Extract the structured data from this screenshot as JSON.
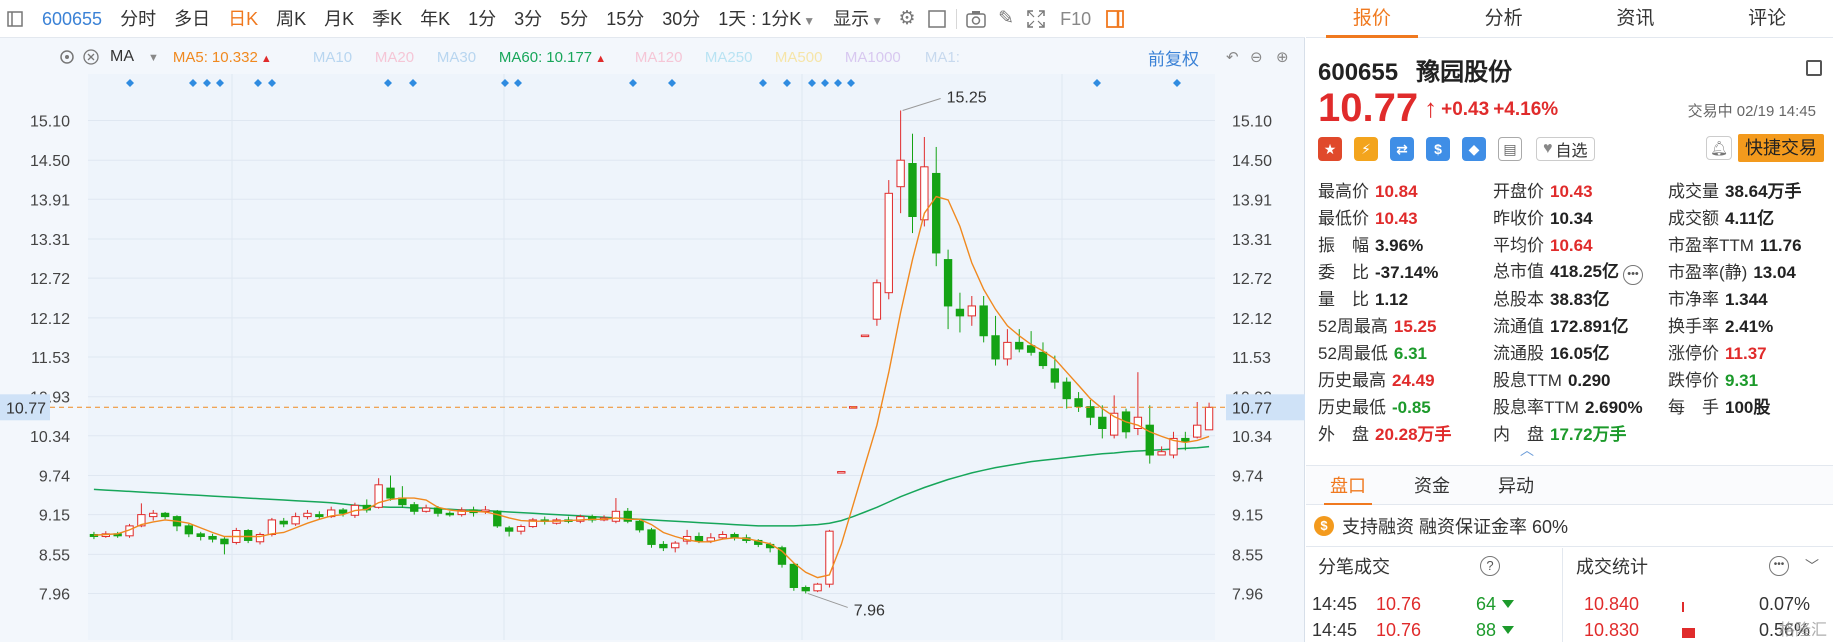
{
  "toolbar": {
    "code": "600655",
    "items": [
      {
        "label": "分时",
        "active": false
      },
      {
        "label": "多日",
        "active": false
      },
      {
        "label": "日K",
        "active": true
      },
      {
        "label": "周K",
        "active": false
      },
      {
        "label": "月K",
        "active": false
      },
      {
        "label": "季K",
        "active": false
      },
      {
        "label": "年K",
        "active": false
      },
      {
        "label": "1分",
        "active": false
      },
      {
        "label": "3分",
        "active": false
      },
      {
        "label": "5分",
        "active": false
      },
      {
        "label": "15分",
        "active": false
      },
      {
        "label": "30分",
        "active": false
      }
    ],
    "period_select": "1天 : 1分K",
    "display_label": "显示",
    "f10_label": "F10"
  },
  "ma_bar": {
    "type_label": "MA",
    "items": [
      {
        "label": "MA5:",
        "value": "10.332",
        "color": "#f0891f",
        "arrow": "up"
      },
      {
        "label": "MA10",
        "value": "",
        "color": "#b8d6f0",
        "arrow": ""
      },
      {
        "label": "MA20",
        "value": "",
        "color": "#f5c6d6",
        "arrow": ""
      },
      {
        "label": "MA30",
        "value": "",
        "color": "#b8d6f0",
        "arrow": ""
      },
      {
        "label": "MA60:",
        "value": "10.177",
        "color": "#17a65a",
        "arrow": "up"
      },
      {
        "label": "MA120",
        "value": "",
        "color": "#f5c6d6",
        "arrow": ""
      },
      {
        "label": "MA250",
        "value": "",
        "color": "#b9e3f3",
        "arrow": ""
      },
      {
        "label": "MA500",
        "value": "",
        "color": "#f6e5a8",
        "arrow": ""
      },
      {
        "label": "MA1000",
        "value": "",
        "color": "#d8c8f0",
        "arrow": ""
      },
      {
        "label": "MA1:",
        "value": "",
        "color": "#c7d9ee",
        "arrow": ""
      }
    ],
    "adjust_label": "前复权"
  },
  "chart_data": {
    "type": "candlestick",
    "y_ticks": [
      "15.10",
      "14.50",
      "13.91",
      "13.31",
      "12.72",
      "12.12",
      "11.53",
      "10.93",
      "10.34",
      "9.74",
      "9.15",
      "8.55",
      "7.96"
    ],
    "y_range": [
      7.68,
      15.62
    ],
    "current_price": "10.77",
    "high_label": "15.25",
    "low_label": "7.96",
    "candles": [
      [
        8.85,
        8.82,
        8.89,
        8.78
      ],
      [
        8.82,
        8.86,
        8.9,
        8.8
      ],
      [
        8.86,
        8.83,
        8.89,
        8.8
      ],
      [
        8.83,
        8.98,
        9.01,
        8.8
      ],
      [
        8.98,
        9.15,
        9.32,
        8.96
      ],
      [
        9.12,
        9.17,
        9.22,
        9.06
      ],
      [
        9.17,
        9.12,
        9.19,
        9.08
      ],
      [
        9.12,
        8.98,
        9.14,
        8.9
      ],
      [
        8.98,
        8.86,
        9.01,
        8.81
      ],
      [
        8.86,
        8.82,
        8.89,
        8.76
      ],
      [
        8.82,
        8.78,
        8.86,
        8.73
      ],
      [
        8.78,
        8.71,
        8.81,
        8.55
      ],
      [
        8.73,
        8.91,
        8.95,
        8.7
      ],
      [
        8.91,
        8.76,
        8.93,
        8.72
      ],
      [
        8.74,
        8.85,
        8.88,
        8.7
      ],
      [
        8.85,
        9.07,
        9.1,
        8.82
      ],
      [
        9.05,
        9.01,
        9.1,
        8.96
      ],
      [
        9.01,
        9.12,
        9.18,
        8.98
      ],
      [
        9.12,
        9.17,
        9.22,
        9.08
      ],
      [
        9.15,
        9.12,
        9.2,
        9.08
      ],
      [
        9.12,
        9.22,
        9.27,
        9.1
      ],
      [
        9.22,
        9.17,
        9.25,
        9.12
      ],
      [
        9.14,
        9.29,
        9.33,
        9.1
      ],
      [
        9.29,
        9.22,
        9.38,
        9.18
      ],
      [
        9.26,
        9.6,
        9.7,
        9.24
      ],
      [
        9.55,
        9.4,
        9.74,
        9.36
      ],
      [
        9.4,
        9.3,
        9.58,
        9.25
      ],
      [
        9.3,
        9.2,
        9.34,
        9.15
      ],
      [
        9.2,
        9.25,
        9.3,
        9.18
      ],
      [
        9.25,
        9.17,
        9.28,
        9.12
      ],
      [
        9.17,
        9.15,
        9.2,
        9.12
      ],
      [
        9.15,
        9.22,
        9.26,
        9.12
      ],
      [
        9.22,
        9.18,
        9.27,
        9.12
      ],
      [
        9.2,
        9.22,
        9.28,
        9.16
      ],
      [
        9.2,
        8.98,
        9.22,
        8.95
      ],
      [
        8.95,
        8.9,
        8.98,
        8.82
      ],
      [
        8.9,
        8.97,
        9.0,
        8.85
      ],
      [
        8.97,
        9.07,
        9.1,
        8.95
      ],
      [
        9.07,
        9.05,
        9.12,
        9.0
      ],
      [
        9.02,
        9.07,
        9.1,
        9.0
      ],
      [
        9.07,
        9.05,
        9.12,
        9.02
      ],
      [
        9.05,
        9.12,
        9.15,
        9.02
      ],
      [
        9.12,
        9.07,
        9.15,
        9.03
      ],
      [
        9.07,
        9.1,
        9.14,
        9.05
      ],
      [
        9.05,
        9.2,
        9.4,
        9.02
      ],
      [
        9.2,
        9.05,
        9.25,
        9.02
      ],
      [
        9.05,
        8.92,
        9.07,
        8.88
      ],
      [
        8.92,
        8.7,
        8.95,
        8.65
      ],
      [
        8.7,
        8.65,
        8.75,
        8.6
      ],
      [
        8.65,
        8.72,
        8.75,
        8.58
      ],
      [
        8.75,
        8.82,
        8.92,
        8.7
      ],
      [
        8.82,
        8.75,
        8.88,
        8.72
      ],
      [
        8.75,
        8.8,
        8.87,
        8.72
      ],
      [
        8.8,
        8.85,
        8.9,
        8.78
      ],
      [
        8.85,
        8.8,
        8.88,
        8.76
      ],
      [
        8.8,
        8.76,
        8.85,
        8.72
      ],
      [
        8.76,
        8.7,
        8.78,
        8.66
      ],
      [
        8.7,
        8.65,
        8.73,
        8.58
      ],
      [
        8.65,
        8.4,
        8.68,
        8.35
      ],
      [
        8.4,
        8.05,
        8.42,
        8.0
      ],
      [
        8.05,
        8.0,
        8.08,
        7.96
      ],
      [
        8.0,
        8.1,
        8.12,
        7.98
      ],
      [
        8.1,
        8.9,
        8.92,
        8.05
      ],
      [
        9.8,
        9.8,
        9.8,
        9.8
      ],
      [
        10.78,
        10.78,
        10.78,
        10.78
      ],
      [
        11.86,
        11.86,
        11.86,
        11.86
      ],
      [
        12.1,
        12.65,
        12.7,
        12.0
      ],
      [
        12.5,
        14.0,
        14.2,
        12.4
      ],
      [
        14.1,
        14.5,
        15.25,
        13.7
      ],
      [
        14.45,
        13.65,
        14.9,
        13.4
      ],
      [
        13.6,
        14.4,
        14.85,
        13.5
      ],
      [
        14.3,
        13.1,
        14.7,
        12.9
      ],
      [
        13.0,
        12.3,
        13.15,
        11.95
      ],
      [
        12.25,
        12.15,
        12.5,
        11.9
      ],
      [
        12.15,
        12.3,
        12.45,
        12.0
      ],
      [
        12.3,
        11.85,
        12.45,
        11.75
      ],
      [
        11.85,
        11.5,
        12.15,
        11.4
      ],
      [
        11.5,
        11.75,
        11.95,
        11.4
      ],
      [
        11.75,
        11.65,
        11.95,
        11.6
      ],
      [
        11.7,
        11.6,
        11.92,
        11.55
      ],
      [
        11.6,
        11.4,
        11.75,
        11.35
      ],
      [
        11.35,
        11.15,
        11.55,
        11.05
      ],
      [
        11.15,
        10.9,
        11.22,
        10.75
      ],
      [
        10.9,
        10.78,
        11.0,
        10.7
      ],
      [
        10.78,
        10.62,
        10.88,
        10.5
      ],
      [
        10.62,
        10.45,
        10.8,
        10.3
      ],
      [
        10.35,
        10.68,
        10.95,
        10.3
      ],
      [
        10.7,
        10.4,
        10.75,
        10.3
      ],
      [
        10.45,
        10.62,
        11.3,
        10.35
      ],
      [
        10.5,
        10.05,
        10.8,
        9.92
      ],
      [
        10.05,
        10.1,
        10.18,
        10.05
      ],
      [
        10.05,
        10.3,
        10.4,
        10.0
      ],
      [
        10.3,
        10.25,
        10.4,
        10.12
      ],
      [
        10.32,
        10.5,
        10.85,
        10.3
      ],
      [
        10.43,
        10.77,
        10.84,
        10.43
      ]
    ],
    "ma5": [
      8.84,
      8.85,
      8.86,
      8.92,
      9.0,
      9.04,
      9.07,
      9.05,
      9.02,
      8.95,
      8.88,
      8.82,
      8.82,
      8.82,
      8.82,
      8.86,
      8.88,
      8.95,
      9.02,
      9.08,
      9.13,
      9.15,
      9.21,
      9.23,
      9.33,
      9.38,
      9.4,
      9.4,
      9.37,
      9.26,
      9.22,
      9.2,
      9.2,
      9.19,
      9.15,
      9.1,
      9.06,
      9.05,
      9.05,
      9.05,
      9.06,
      9.07,
      9.08,
      9.08,
      9.1,
      9.08,
      9.08,
      9.0,
      8.88,
      8.82,
      8.77,
      8.74,
      8.74,
      8.78,
      8.8,
      8.79,
      8.75,
      8.71,
      8.6,
      8.42,
      8.28,
      8.2,
      8.24,
      8.7,
      9.3,
      9.9,
      10.5,
      11.3,
      12.2,
      13.0,
      13.7,
      13.95,
      13.9,
      13.5,
      12.95,
      12.55,
      12.25,
      12.0,
      11.85,
      11.72,
      11.62,
      11.5,
      11.3,
      11.1,
      10.9,
      10.75,
      10.63,
      10.55,
      10.5,
      10.4,
      10.33,
      10.27,
      10.24,
      10.27,
      10.33
    ],
    "ma60": [
      9.53,
      9.52,
      9.51,
      9.5,
      9.49,
      9.48,
      9.47,
      9.46,
      9.45,
      9.44,
      9.43,
      9.42,
      9.41,
      9.4,
      9.39,
      9.38,
      9.37,
      9.36,
      9.35,
      9.34,
      9.33,
      9.31,
      9.29,
      9.28,
      9.27,
      9.26,
      9.26,
      9.25,
      9.25,
      9.24,
      9.23,
      9.22,
      9.22,
      9.21,
      9.2,
      9.19,
      9.18,
      9.17,
      9.16,
      9.15,
      9.14,
      9.13,
      9.12,
      9.11,
      9.1,
      9.09,
      9.08,
      9.07,
      9.06,
      9.05,
      9.04,
      9.03,
      9.02,
      9.01,
      9.0,
      8.99,
      8.98,
      8.98,
      8.98,
      8.98,
      8.99,
      9.0,
      9.02,
      9.06,
      9.12,
      9.19,
      9.26,
      9.34,
      9.42,
      9.49,
      9.56,
      9.62,
      9.68,
      9.73,
      9.78,
      9.82,
      9.86,
      9.89,
      9.92,
      9.95,
      9.97,
      9.99,
      10.01,
      10.03,
      10.05,
      10.07,
      10.08,
      10.1,
      10.11,
      10.12,
      10.13,
      10.14,
      10.15,
      10.16,
      10.177
    ]
  },
  "stock": {
    "code": "600655",
    "name": "豫园股份",
    "price": "10.77",
    "change": "+0.43",
    "change_pct": "+4.16%",
    "status": "交易中 02/19 14:45",
    "watch_label": "自选",
    "quick_trade": "快捷交易"
  },
  "right_tabs": [
    "报价",
    "分析",
    "资讯",
    "评论"
  ],
  "quote_rows": [
    [
      {
        "l": "最高价",
        "v": "10.84",
        "c": "red"
      },
      {
        "l": "开盘价",
        "v": "10.43",
        "c": "red"
      },
      {
        "l": "成交量",
        "v": "38.64万手",
        "c": ""
      }
    ],
    [
      {
        "l": "最低价",
        "v": "10.43",
        "c": "red"
      },
      {
        "l": "昨收价",
        "v": "10.34",
        "c": ""
      },
      {
        "l": "成交额",
        "v": "4.11亿",
        "c": ""
      }
    ],
    [
      {
        "l": "振　幅",
        "v": "3.96%",
        "c": ""
      },
      {
        "l": "平均价",
        "v": "10.64",
        "c": "red"
      },
      {
        "l": "市盈率TTM",
        "v": "11.76",
        "c": ""
      }
    ],
    [
      {
        "l": "委　比",
        "v": "-37.14%",
        "c": ""
      },
      {
        "l": "总市值",
        "v": "418.25亿",
        "c": "",
        "more": true
      },
      {
        "l": "市盈率(静)",
        "v": "13.04",
        "c": ""
      }
    ],
    [
      {
        "l": "量　比",
        "v": "1.12",
        "c": ""
      },
      {
        "l": "总股本",
        "v": "38.83亿",
        "c": ""
      },
      {
        "l": "市净率",
        "v": "1.344",
        "c": ""
      }
    ],
    [
      {
        "l": "52周最高",
        "v": "15.25",
        "c": "red"
      },
      {
        "l": "流通值",
        "v": "172.891亿",
        "c": ""
      },
      {
        "l": "换手率",
        "v": "2.41%",
        "c": ""
      }
    ],
    [
      {
        "l": "52周最低",
        "v": "6.31",
        "c": "green"
      },
      {
        "l": "流通股",
        "v": "16.05亿",
        "c": ""
      },
      {
        "l": "涨停价",
        "v": "11.37",
        "c": "red"
      }
    ],
    [
      {
        "l": "历史最高",
        "v": "24.49",
        "c": "red"
      },
      {
        "l": "股息TTM",
        "v": "0.290",
        "c": ""
      },
      {
        "l": "跌停价",
        "v": "9.31",
        "c": "green"
      }
    ],
    [
      {
        "l": "历史最低",
        "v": "-0.85",
        "c": "green"
      },
      {
        "l": "股息率TTM",
        "v": "2.690%",
        "c": ""
      },
      {
        "l": "每　手",
        "v": "100股",
        "c": ""
      }
    ],
    [
      {
        "l": "外　盘",
        "v": "20.28万手",
        "c": "red"
      },
      {
        "l": "内　盘",
        "v": "17.72万手",
        "c": "green"
      },
      {
        "l": "",
        "v": "",
        "c": ""
      }
    ]
  ],
  "sub_tabs": [
    "盘口",
    "资金",
    "异动"
  ],
  "margin_text": "支持融资 融资保证金率 60%",
  "ticks_title": "分笔成交",
  "stats_title": "成交统计",
  "ticks": [
    {
      "time": "14:45",
      "price": "10.76",
      "vol": "64"
    },
    {
      "time": "14:45",
      "price": "10.76",
      "vol": "88"
    }
  ],
  "stats": [
    {
      "price": "10.840",
      "pct": "0.07%",
      "bar": 0.07
    },
    {
      "price": "10.830",
      "pct": "0.56%",
      "bar": 0.56
    }
  ],
  "watermark": "格隆汇"
}
